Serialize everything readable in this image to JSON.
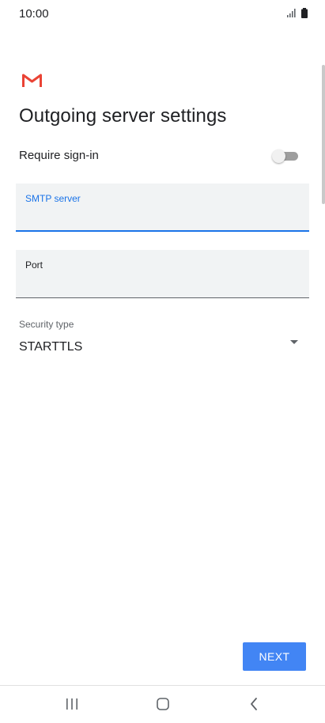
{
  "status_bar": {
    "time": "10:00",
    "icons": [
      "signal-icon",
      "battery-icon"
    ]
  },
  "app": {
    "logo": "gmail-logo-icon",
    "accent_color": "#ea4335"
  },
  "page": {
    "title": "Outgoing server settings"
  },
  "require_signin": {
    "label": "Require sign-in",
    "enabled": false
  },
  "smtp_server": {
    "label": "SMTP server",
    "value": "",
    "focused": true,
    "focus_color": "#1a73e8"
  },
  "port": {
    "label": "Port",
    "value": ""
  },
  "security_type": {
    "label": "Security type",
    "value": "STARTTLS"
  },
  "actions": {
    "next_label": "NEXT",
    "next_color": "#4285f4"
  },
  "nav_bar": {
    "buttons": [
      "recents-icon",
      "home-icon",
      "back-icon"
    ]
  }
}
